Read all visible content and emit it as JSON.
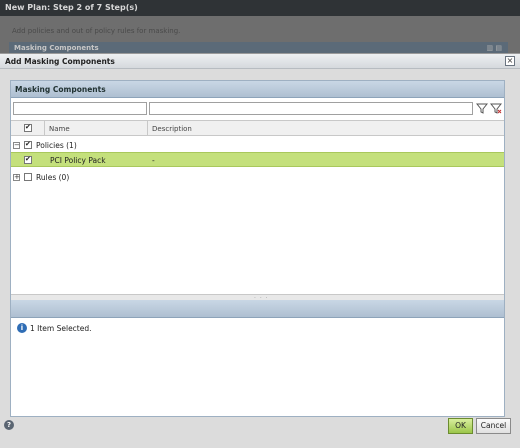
{
  "background": {
    "title": "New Plan: Step 2 of 7 Step(s)",
    "subtitle": "Add policies and out of policy rules for masking.",
    "strip_title": "Masking Components"
  },
  "dialog": {
    "title": "Add Masking Components",
    "close_label": "×",
    "panel_title": "Masking Components",
    "filters": {
      "name_value": "",
      "description_value": ""
    },
    "columns": {
      "name": "Name",
      "description": "Description"
    },
    "tree": {
      "policies_label": "Policies (1)",
      "policy_item": {
        "name": "PCI Policy Pack",
        "description": "-"
      },
      "rules_label": "Rules (0)"
    },
    "splitter_grip": "· · ·",
    "status": {
      "info_glyph": "i",
      "text": "1 Item Selected."
    },
    "footer": {
      "help_glyph": "?",
      "ok_label": "OK",
      "cancel_label": "Cancel"
    }
  },
  "icons": [
    "filter-icon",
    "clear-filter-icon",
    "info-icon",
    "help-icon",
    "close-icon"
  ],
  "colors": {
    "selected_row": "#c4e07c",
    "panel_header": "#b9c9da",
    "ok_button": "#a8cf58"
  }
}
